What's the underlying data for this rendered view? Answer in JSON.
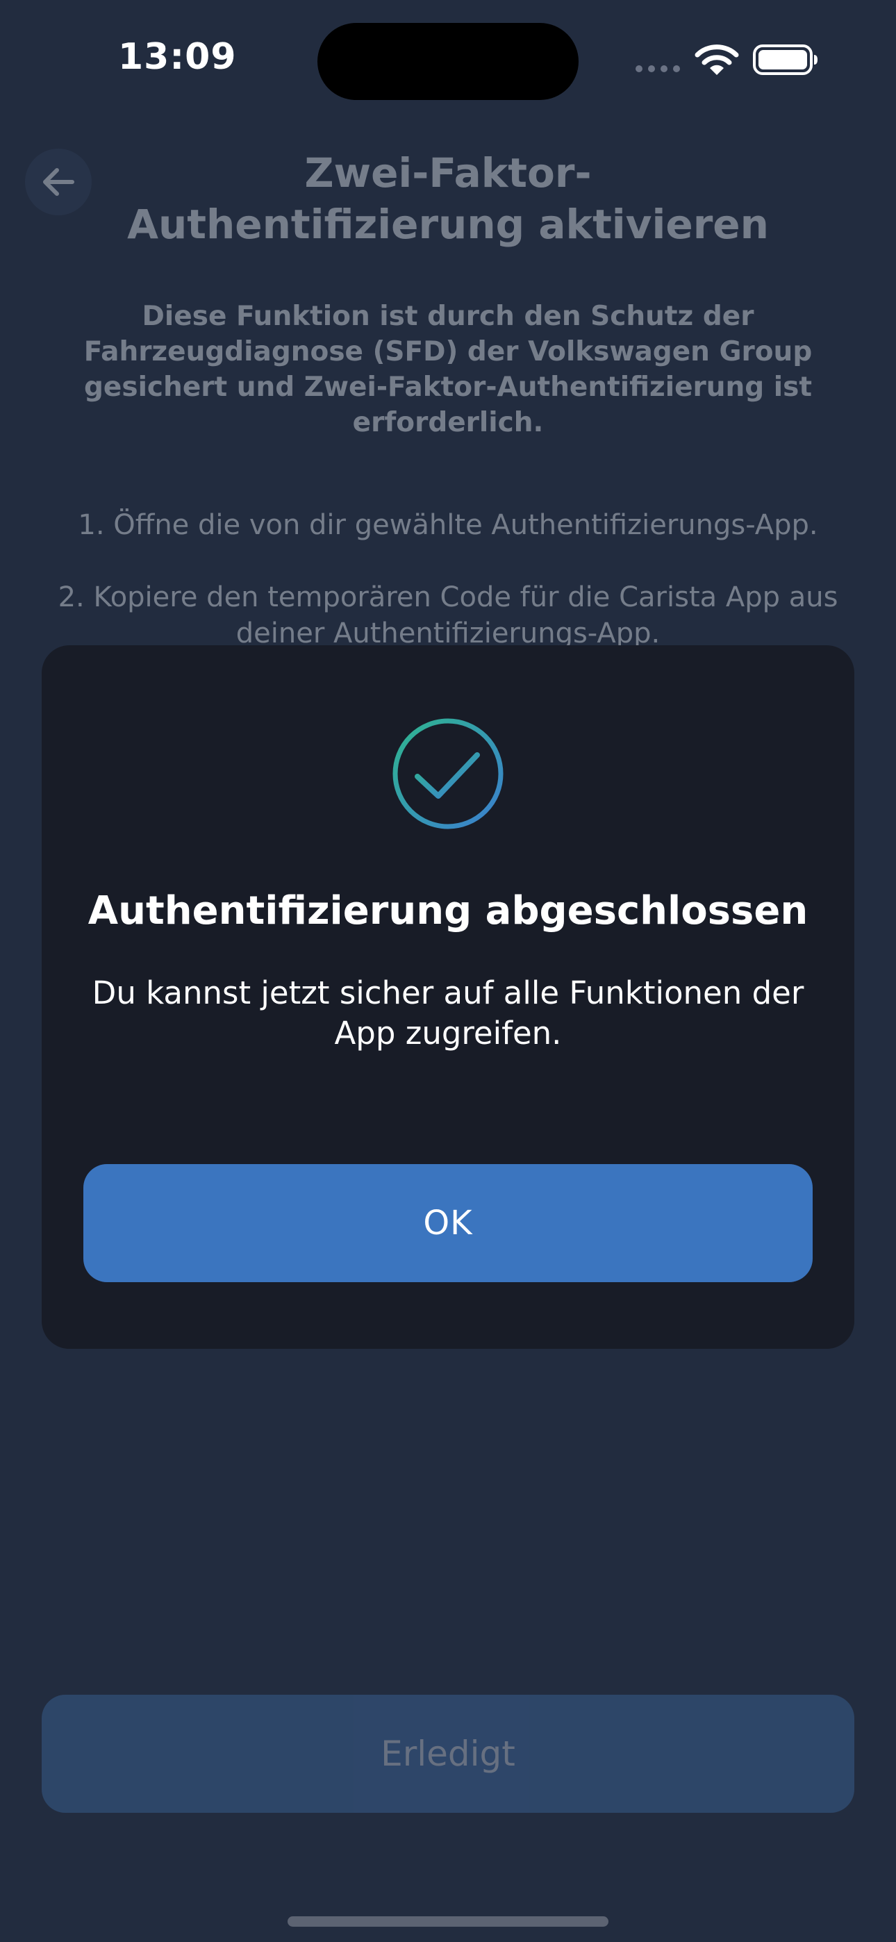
{
  "status_bar": {
    "time": "13:09"
  },
  "page": {
    "title": "Zwei-Faktor-Authentifizierung aktivieren",
    "intro": "Diese Funktion ist durch den Schutz der Fahrzeugdiagnose (SFD) der Volkswagen Group gesichert und Zwei-Faktor-Authentifizierung ist erforderlich.",
    "step_1": "1. Öffne die von dir gewählte Authentifizierungs-App.",
    "step_2": "2. Kopiere den temporären Code für die Carista App aus deiner Authentifizierungs-App.",
    "done_label": "Erledigt"
  },
  "dialog": {
    "title": "Authentifizierung abgeschlossen",
    "message": "Du kannst jetzt sicher auf alle Funktionen der App zugreifen.",
    "ok_label": "OK",
    "icon": "check-circle-icon"
  },
  "colors": {
    "background": "#222c3f",
    "dialog_background": "#181c27",
    "primary_button": "#3b75bf",
    "check_gradient_start": "#2fb58f",
    "check_gradient_end": "#3b7fd0"
  }
}
